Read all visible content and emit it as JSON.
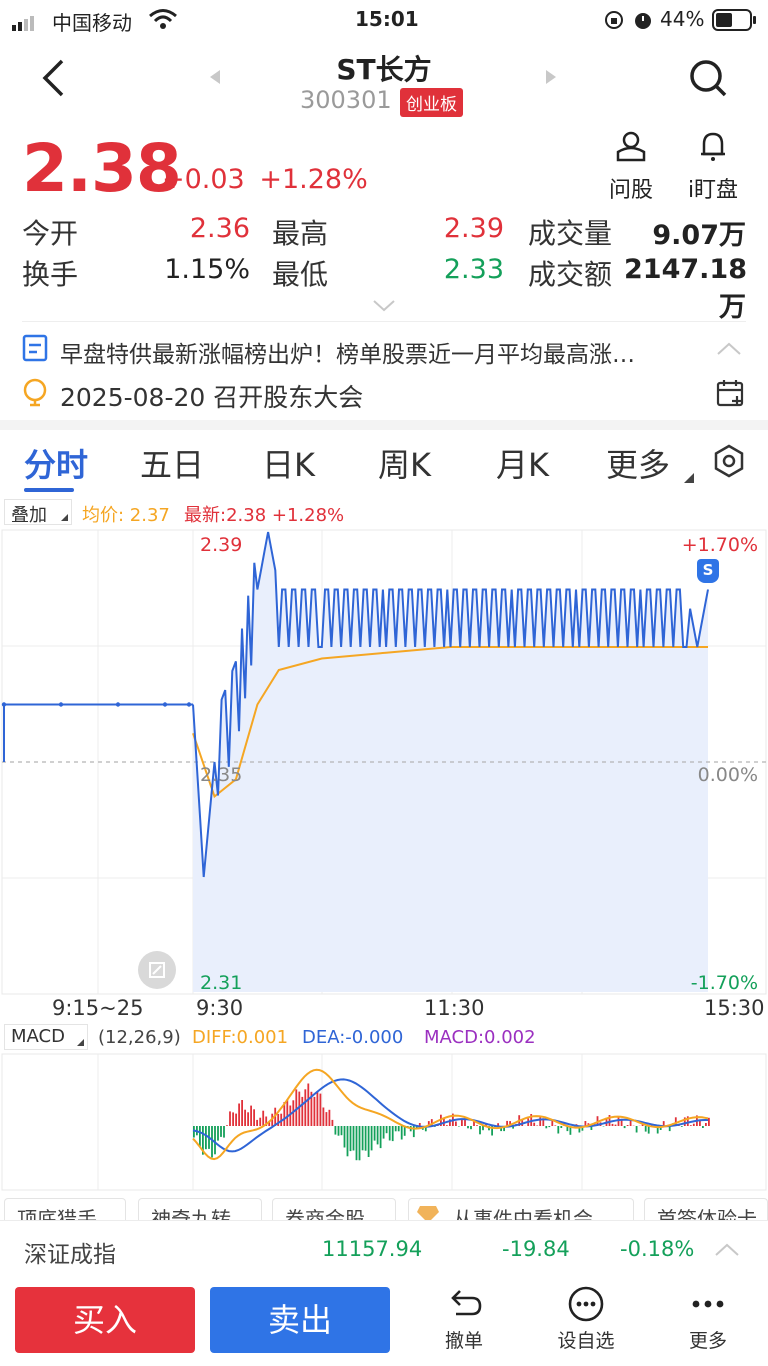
{
  "status_bar": {
    "carrier": "中国移动",
    "time": "15:01",
    "battery": "44%"
  },
  "header": {
    "title": "ST长方",
    "code": "300301",
    "board_tag": "创业板"
  },
  "quote": {
    "price": "2.38",
    "change": "+0.03",
    "change_pct": "+1.28%"
  },
  "quick_actions": {
    "ask": "问股",
    "watch": "i盯盘"
  },
  "metrics": {
    "open_label": "今开",
    "open": "2.36",
    "high_label": "最高",
    "high": "2.39",
    "volume_label": "成交量",
    "volume": "9.07万",
    "turnover_label": "换手",
    "turnover": "1.15%",
    "low_label": "最低",
    "low": "2.33",
    "amount_label": "成交额",
    "amount": "2147.18万"
  },
  "news": {
    "headline": "早盘特供最新涨幅榜出炉！榜单股票近一月平均最高涨…",
    "event": "2025-08-20 召开股东大会"
  },
  "tabs": [
    "分时",
    "五日",
    "日K",
    "周K",
    "月K",
    "更多"
  ],
  "overlay": {
    "button": "叠加",
    "avg_label": "均价: 2.37",
    "latest_label": "最新:2.38 +1.28%"
  },
  "chart_labels": {
    "y_top": "2.39",
    "y_mid": "2.35",
    "y_bot": "2.31",
    "pct_top": "+1.70%",
    "pct_mid": "0.00%",
    "pct_bot": "-1.70%",
    "x_pre": "9:15~25",
    "x_open": "9:30",
    "x_mid": "11:30",
    "x_close": "15:30",
    "sell_marker": "S"
  },
  "macd": {
    "label": "MACD",
    "params": "(12,26,9)",
    "diff": "DIFF:0.001",
    "dea": "DEA:-0.000",
    "macd_val": "MACD:0.002"
  },
  "chips": [
    "顶底猎手",
    "神奇九转",
    "券商金股",
    "从事件中看机会",
    "首签体验卡"
  ],
  "index_bar": {
    "name": "深证成指",
    "value": "11157.94",
    "change": "-19.84",
    "pct": "-0.18%"
  },
  "bottom": {
    "buy": "买入",
    "sell": "卖出",
    "cancel": "撤单",
    "watchlist": "设自选",
    "more": "更多"
  },
  "colors": {
    "up": "#e0313a",
    "down": "#14a05a",
    "price_line": "#2f65d6",
    "avg_line": "#f5a623",
    "sell_button": "#2f74e6"
  },
  "chart_data": [
    {
      "type": "line",
      "title": "",
      "ylim": [
        2.31,
        2.39
      ],
      "reference_price": 2.35,
      "xticks": [
        "9:15~25",
        "9:30",
        "11:30",
        "15:30"
      ],
      "series": [
        {
          "name": "最新",
          "x_minutes_from_open": [
            0,
            5,
            10,
            15,
            20,
            30,
            35,
            40,
            60,
            90,
            120,
            150,
            180,
            210,
            230,
            235,
            240
          ],
          "values": [
            2.36,
            2.33,
            2.35,
            2.355,
            2.36,
            2.38,
            2.39,
            2.38,
            2.38,
            2.38,
            2.38,
            2.38,
            2.38,
            2.38,
            2.38,
            2.37,
            2.38
          ]
        },
        {
          "name": "均价",
          "x_minutes_from_open": [
            0,
            10,
            20,
            30,
            40,
            60,
            90,
            120,
            150,
            180,
            210,
            240
          ],
          "values": [
            2.355,
            2.344,
            2.347,
            2.36,
            2.366,
            2.368,
            2.369,
            2.37,
            2.37,
            2.37,
            2.37,
            2.37
          ]
        }
      ]
    },
    {
      "type": "bar",
      "title": "MACD",
      "series": [
        {
          "name": "DIFF",
          "value": 0.001
        },
        {
          "name": "DEA",
          "value": -0.0
        },
        {
          "name": "MACD",
          "value": 0.002
        }
      ]
    }
  ]
}
